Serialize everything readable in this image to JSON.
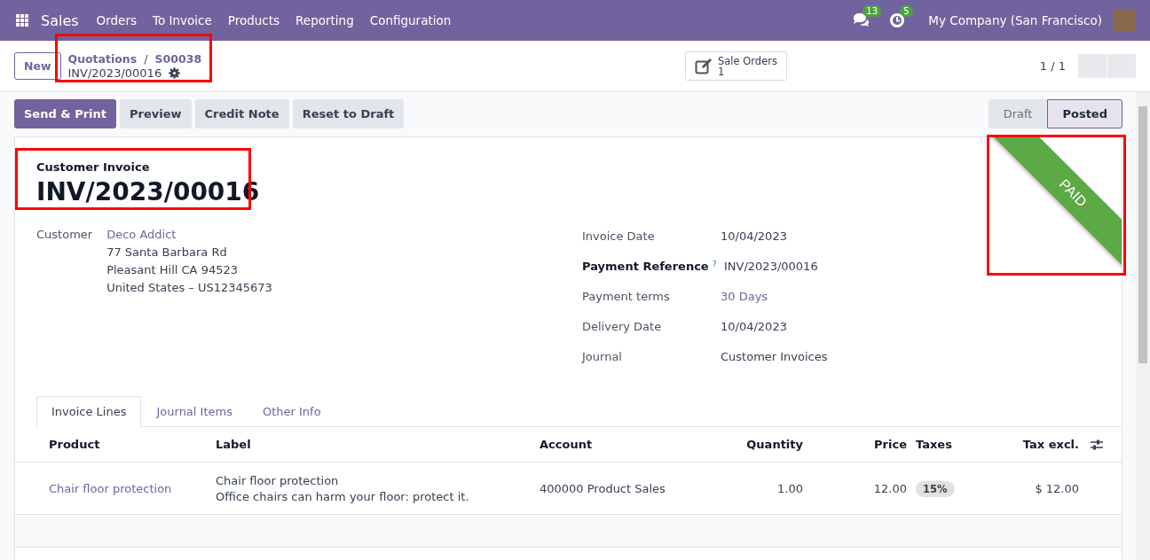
{
  "navbar": {
    "app": "Sales",
    "menu": [
      "Orders",
      "To Invoice",
      "Products",
      "Reporting",
      "Configuration"
    ],
    "messages_count": "13",
    "activities_count": "5",
    "company": "My Company (San Francisco)"
  },
  "control_panel": {
    "new_button": "New",
    "breadcrumbs": [
      "Quotations",
      "S00038"
    ],
    "breadcrumb_separator": "/",
    "record": "INV/2023/00016",
    "smart_button": {
      "label": "Sale Orders",
      "count": "1"
    },
    "pager": "1 / 1"
  },
  "actions": [
    {
      "label": "Send & Print",
      "primary": true
    },
    {
      "label": "Preview",
      "primary": false
    },
    {
      "label": "Credit Note",
      "primary": false
    },
    {
      "label": "Reset to Draft",
      "primary": false
    }
  ],
  "statusbar": [
    {
      "label": "Draft",
      "selected": false
    },
    {
      "label": "Posted",
      "selected": true
    }
  ],
  "ribbon": "PAID",
  "sheet": {
    "type": "Customer Invoice",
    "number": "INV/2023/00016",
    "customer": {
      "label": "Customer",
      "name": "Deco Addict",
      "address": [
        "77 Santa Barbara Rd",
        "Pleasant Hill CA 94523",
        "United States – US12345673"
      ]
    },
    "fields": [
      {
        "label": "Invoice Date",
        "value": "10/04/2023",
        "kind": "text",
        "bold": false
      },
      {
        "label": "Payment Reference",
        "help": "?",
        "value": "INV/2023/00016",
        "kind": "text",
        "bold": true
      },
      {
        "label": "Payment terms",
        "value": "30 Days",
        "kind": "link",
        "bold": false
      },
      {
        "label": "Delivery Date",
        "value": "10/04/2023",
        "kind": "text",
        "bold": false
      },
      {
        "label": "Journal",
        "value": "Customer Invoices",
        "kind": "text",
        "bold": false
      }
    ]
  },
  "tabs": [
    {
      "label": "Invoice Lines",
      "selected": true
    },
    {
      "label": "Journal Items",
      "selected": false
    },
    {
      "label": "Other Info",
      "selected": false
    }
  ],
  "table": {
    "columns": [
      "Product",
      "Label",
      "Account",
      "Quantity",
      "Price",
      "Taxes",
      "Tax excl."
    ],
    "rows": [
      {
        "product": "Chair floor protection",
        "label": [
          "Chair floor protection",
          "Office chairs can harm your floor: protect it."
        ],
        "account": "400000 Product Sales",
        "quantity": "1.00",
        "price": "12.00",
        "tax": "15%",
        "subtotal": "$ 12.00"
      }
    ]
  }
}
